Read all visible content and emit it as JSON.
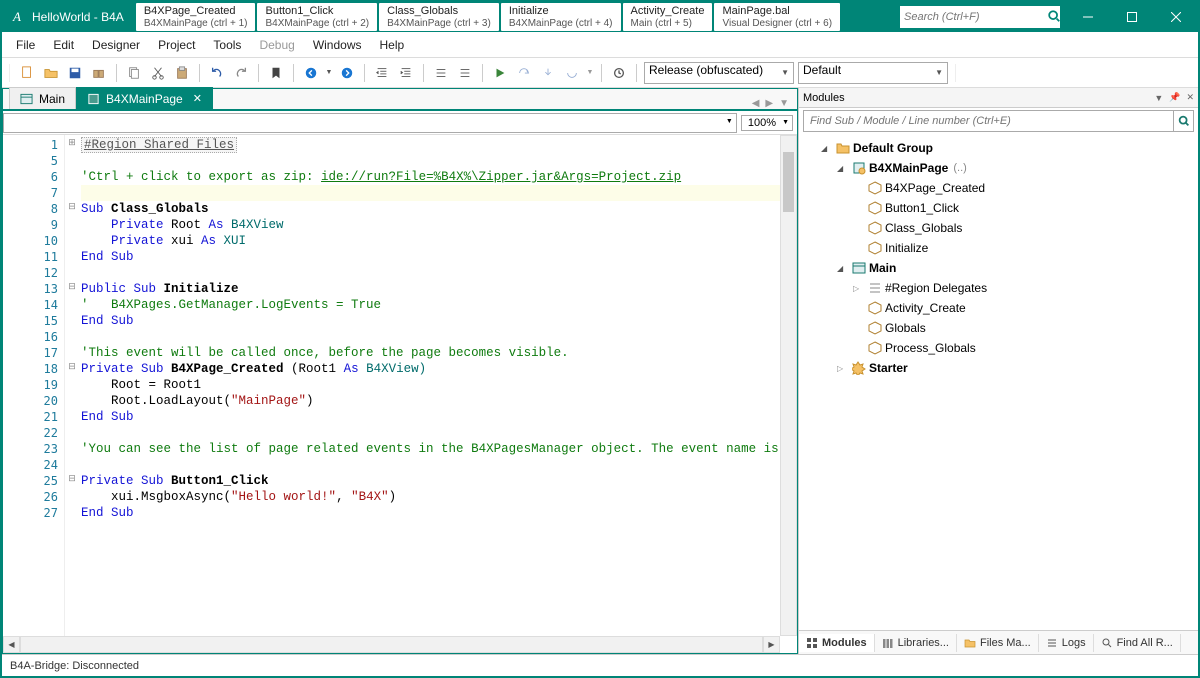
{
  "title": "HelloWorld - B4A",
  "topTabs": [
    {
      "main": "B4XPage_Created",
      "sub": "B4XMainPage  (ctrl + 1)"
    },
    {
      "main": "Button1_Click",
      "sub": "B4XMainPage  (ctrl + 2)"
    },
    {
      "main": "Class_Globals",
      "sub": "B4XMainPage  (ctrl + 3)"
    },
    {
      "main": "Initialize",
      "sub": "B4XMainPage  (ctrl + 4)"
    },
    {
      "main": "Activity_Create",
      "sub": "Main  (ctrl + 5)"
    },
    {
      "main": "MainPage.bal",
      "sub": "Visual Designer  (ctrl + 6)"
    }
  ],
  "searchPlaceholder": "Search (Ctrl+F)",
  "menus": [
    "File",
    "Edit",
    "Designer",
    "Project",
    "Tools",
    "Debug",
    "Windows",
    "Help"
  ],
  "toolbar": {
    "buildConfig": "Release (obfuscated)",
    "runConfig": "Default"
  },
  "editorTabs": {
    "tab1": "Main",
    "tab2": "B4XMainPage"
  },
  "zoom": "100%",
  "lineNumbers": [
    "1",
    "5",
    "6",
    "7",
    "8",
    "9",
    "10",
    "11",
    "12",
    "13",
    "14",
    "15",
    "16",
    "17",
    "18",
    "19",
    "20",
    "21",
    "22",
    "23",
    "24",
    "25",
    "26",
    "27"
  ],
  "code": {
    "l1": "#Region Shared Files",
    "l6c": "'Ctrl + click to export as zip: ",
    "l6l": "ide://run?File=%B4X%\\Zipper.jar&Args=Project.zip",
    "l8a": "Sub",
    "l8b": " Class_Globals",
    "l9a": "    Private",
    "l9b": " Root ",
    "l9c": "As",
    "l9d": " B4XView",
    "l10a": "    Private",
    "l10b": " xui ",
    "l10c": "As",
    "l10d": " XUI",
    "l11": "End Sub",
    "l13a": "Public Sub",
    "l13b": " Initialize",
    "l14": "'   B4XPages.GetManager.LogEvents = True",
    "l15": "End Sub",
    "l17": "'This event will be called once, before the page becomes visible.",
    "l18a": "Private Sub",
    "l18b": " B4XPage_Created ",
    "l18c": "(Root1 ",
    "l18d": "As",
    "l18e": " B4XView)",
    "l19": "    Root = Root1",
    "l20a": "    Root.LoadLayout(",
    "l20b": "\"MainPage\"",
    "l20c": ")",
    "l21": "End Sub",
    "l23": "'You can see the list of page related events in the B4XPagesManager object. The event name is",
    "l25a": "Private Sub",
    "l25b": " Button1_Click",
    "l26a": "    xui.MsgboxAsync(",
    "l26b": "\"Hello world!\"",
    "l26c": ", ",
    "l26d": "\"B4X\"",
    "l26e": ")",
    "l27": "End Sub"
  },
  "modulesPanel": {
    "title": "Modules",
    "searchPlaceholder": "Find Sub / Module / Line number (Ctrl+E)",
    "defaultGroup": "Default Group",
    "b4xmain": "B4XMainPage",
    "b4xmainExt": "(..)",
    "items1": [
      "B4XPage_Created",
      "Button1_Click",
      "Class_Globals",
      "Initialize"
    ],
    "main": "Main",
    "regionDel": "#Region Delegates",
    "items2": [
      "Activity_Create",
      "Globals",
      "Process_Globals"
    ],
    "starter": "Starter"
  },
  "bottomTabs": [
    "Modules",
    "Libraries...",
    "Files Ma...",
    "Logs",
    "Find All R..."
  ],
  "status": "B4A-Bridge: Disconnected"
}
